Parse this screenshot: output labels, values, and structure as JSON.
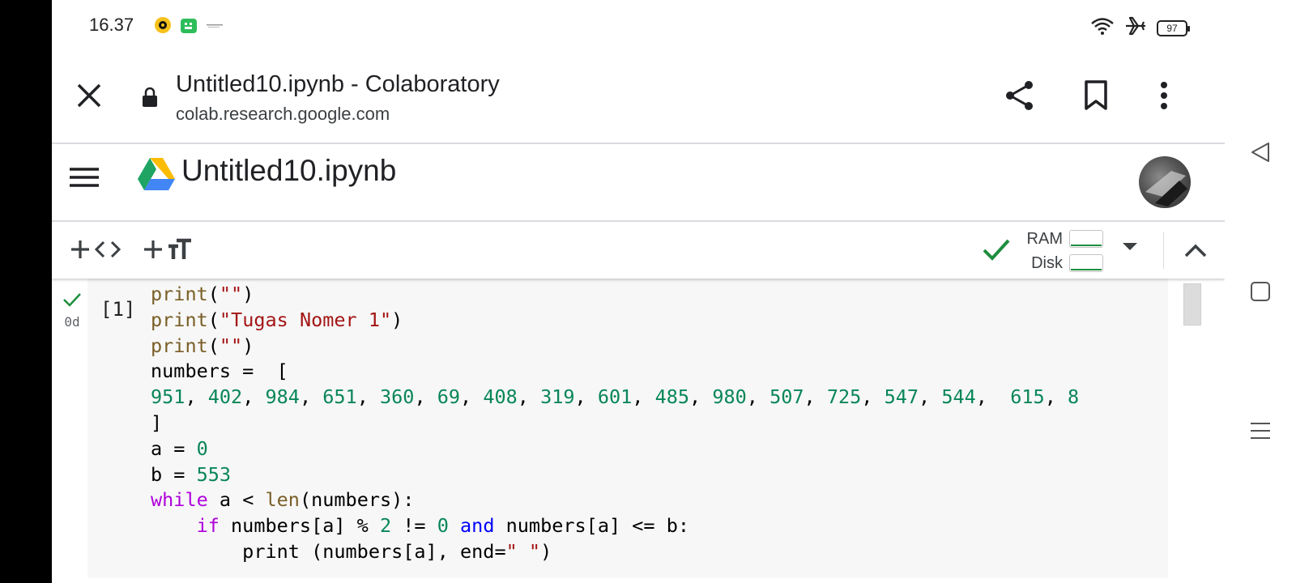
{
  "status_bar": {
    "time": "16.37",
    "battery": "97"
  },
  "browser": {
    "page_title": "Untitled10.ipynb - Colaboratory",
    "url": "colab.research.google.com"
  },
  "notebook": {
    "title": "Untitled10.ipynb"
  },
  "toolbar": {
    "ram_label": "RAM",
    "disk_label": "Disk",
    "status_color": "#1e8e3e"
  },
  "cell": {
    "execution_count": "[1]",
    "execution_time": "0d",
    "lines": [
      [
        {
          "t": "print",
          "c": "fn"
        },
        {
          "t": "(",
          "c": "pl"
        },
        {
          "t": "\"\"",
          "c": "str"
        },
        {
          "t": ")",
          "c": "pl"
        }
      ],
      [
        {
          "t": "print",
          "c": "fn"
        },
        {
          "t": "(",
          "c": "pl"
        },
        {
          "t": "\"Tugas Nomer 1\"",
          "c": "str"
        },
        {
          "t": ")",
          "c": "pl"
        }
      ],
      [
        {
          "t": "print",
          "c": "fn"
        },
        {
          "t": "(",
          "c": "pl"
        },
        {
          "t": "\"\"",
          "c": "str"
        },
        {
          "t": ")",
          "c": "pl"
        }
      ],
      [
        {
          "t": "numbers =  [",
          "c": "pl"
        }
      ],
      [
        {
          "t": "951",
          "c": "num"
        },
        {
          "t": ", ",
          "c": "pl"
        },
        {
          "t": "402",
          "c": "num"
        },
        {
          "t": ", ",
          "c": "pl"
        },
        {
          "t": "984",
          "c": "num"
        },
        {
          "t": ", ",
          "c": "pl"
        },
        {
          "t": "651",
          "c": "num"
        },
        {
          "t": ", ",
          "c": "pl"
        },
        {
          "t": "360",
          "c": "num"
        },
        {
          "t": ", ",
          "c": "pl"
        },
        {
          "t": "69",
          "c": "num"
        },
        {
          "t": ", ",
          "c": "pl"
        },
        {
          "t": "408",
          "c": "num"
        },
        {
          "t": ", ",
          "c": "pl"
        },
        {
          "t": "319",
          "c": "num"
        },
        {
          "t": ", ",
          "c": "pl"
        },
        {
          "t": "601",
          "c": "num"
        },
        {
          "t": ", ",
          "c": "pl"
        },
        {
          "t": "485",
          "c": "num"
        },
        {
          "t": ", ",
          "c": "pl"
        },
        {
          "t": "980",
          "c": "num"
        },
        {
          "t": ", ",
          "c": "pl"
        },
        {
          "t": "507",
          "c": "num"
        },
        {
          "t": ", ",
          "c": "pl"
        },
        {
          "t": "725",
          "c": "num"
        },
        {
          "t": ", ",
          "c": "pl"
        },
        {
          "t": "547",
          "c": "num"
        },
        {
          "t": ", ",
          "c": "pl"
        },
        {
          "t": "544",
          "c": "num"
        },
        {
          "t": ",  ",
          "c": "pl"
        },
        {
          "t": "615",
          "c": "num"
        },
        {
          "t": ", ",
          "c": "pl"
        },
        {
          "t": "8",
          "c": "num"
        }
      ],
      [
        {
          "t": "]",
          "c": "pl"
        }
      ],
      [
        {
          "t": "a = ",
          "c": "pl"
        },
        {
          "t": "0",
          "c": "num"
        }
      ],
      [
        {
          "t": "b = ",
          "c": "pl"
        },
        {
          "t": "553",
          "c": "num"
        }
      ],
      [
        {
          "t": "while",
          "c": "kw"
        },
        {
          "t": " a < ",
          "c": "pl"
        },
        {
          "t": "len",
          "c": "fn"
        },
        {
          "t": "(numbers):",
          "c": "pl"
        }
      ],
      [
        {
          "t": "    ",
          "c": "pl"
        },
        {
          "t": "if",
          "c": "kw"
        },
        {
          "t": " numbers[a] % ",
          "c": "pl"
        },
        {
          "t": "2",
          "c": "num"
        },
        {
          "t": " != ",
          "c": "pl"
        },
        {
          "t": "0",
          "c": "num"
        },
        {
          "t": " ",
          "c": "pl"
        },
        {
          "t": "and",
          "c": "op"
        },
        {
          "t": " numbers[a] <= b:",
          "c": "pl"
        }
      ],
      [
        {
          "t": "        print (numbers[a], end=",
          "c": "pl"
        },
        {
          "t": "\" \"",
          "c": "str"
        },
        {
          "t": ")",
          "c": "pl"
        }
      ]
    ]
  }
}
